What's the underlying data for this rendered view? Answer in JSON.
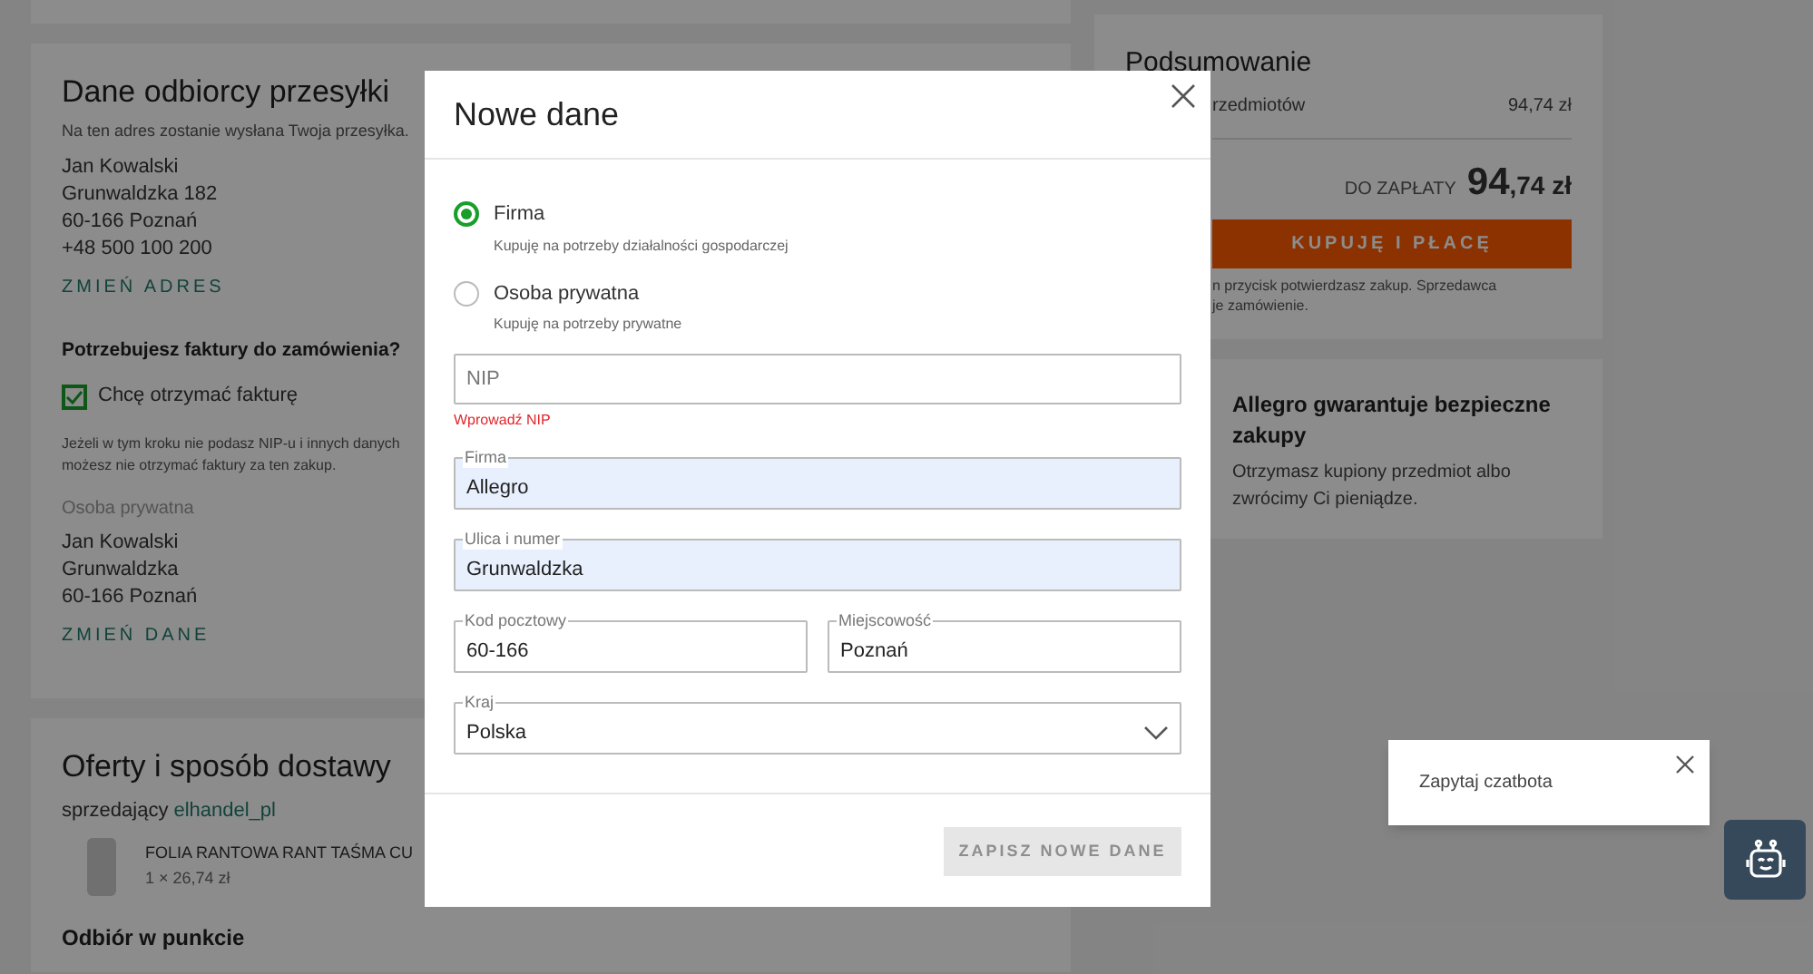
{
  "recipient": {
    "title": "Dane odbiorcy przesyłki",
    "note": "Na ten adres zostanie wysłana Twoja przesyłka.",
    "address": [
      "Jan Kowalski",
      "Grunwaldzka 182",
      "60-166 Poznań",
      "+48 500 100 200"
    ],
    "change_link": "ZMIEŃ ADRES"
  },
  "invoice": {
    "title": "Potrzebujesz faktury do zamówienia?",
    "checkbox": {
      "label": "Chcę otrzymać fakturę",
      "checked": true
    },
    "note": [
      "Jeżeli w tym kroku nie podasz NIP-u i innych danych",
      "możesz nie otrzymać faktury za ten zakup."
    ],
    "buyer_type": "Osoba prywatna",
    "buyer": [
      "Jan Kowalski",
      "Grunwaldzka",
      "60-166 Poznań"
    ],
    "change_link": "ZMIEŃ DANE"
  },
  "offers": {
    "title": "Oferty i sposób dostawy",
    "seller_label": "sprzedający",
    "seller": "elhandel_pl",
    "product": {
      "name": "FOLIA RANTOWA RANT TAŚMA CU",
      "price": "1 × 26,74 zł"
    },
    "pickup_title": "Odbiór w punkcie"
  },
  "summary": {
    "title": "Podsumowanie",
    "items_label": "rzedmiotów",
    "items_value": "94,74 zł",
    "total_label": "DO ZAPŁATY",
    "total_main": "94",
    "total_rest": ",74 zł",
    "buy_button": "KUPUJĘ I PŁACĘ",
    "note": [
      "n przycisk potwierdzasz zakup. Sprzedawca",
      "je zamówienie."
    ]
  },
  "guarantee": {
    "title": "Allegro gwarantuje bezpieczne zakupy",
    "text": "Otrzymasz kupiony przedmiot albo zwrócimy Ci pieniądze."
  },
  "modal": {
    "title": "Nowe dane",
    "options": [
      {
        "label": "Firma",
        "hint": "Kupuję na potrzeby działalności gospodarczej",
        "selected": true
      },
      {
        "label": "Osoba prywatna",
        "hint": "Kupuję na potrzeby prywatne",
        "selected": false
      }
    ],
    "rows": [
      [
        {
          "kind": "input",
          "placeholder": "NIP",
          "error": "Wprowadź NIP",
          "autofilled": false
        }
      ],
      [
        {
          "kind": "input",
          "label": "Firma",
          "value": "Allegro",
          "autofilled": true
        }
      ],
      [
        {
          "kind": "input",
          "label": "Ulica i numer",
          "value": "Grunwaldzka",
          "autofilled": true
        }
      ],
      [
        {
          "kind": "input",
          "label": "Kod pocztowy",
          "value": "60-166",
          "autofilled": false
        },
        {
          "kind": "input",
          "label": "Miejscowość",
          "value": "Poznań",
          "autofilled": false
        }
      ],
      [
        {
          "kind": "select",
          "label": "Kraj",
          "value": "Polska",
          "autofilled": false
        }
      ]
    ],
    "save_button": {
      "label": "ZAPISZ NOWE DANE",
      "disabled": true
    }
  },
  "chat": {
    "prompt": "Zapytaj czatbota"
  }
}
